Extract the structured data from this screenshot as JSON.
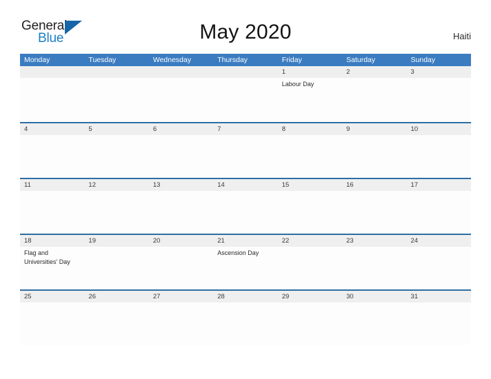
{
  "brand": {
    "name_part1": "General",
    "name_part2": "Blue",
    "flag_icon": "blue-triangle-flag-icon",
    "accent_color": "#1d7ec4"
  },
  "header": {
    "title": "May 2020",
    "country": "Haiti"
  },
  "colors": {
    "weekday_header_bg": "#3b7cc1",
    "week_divider": "#2e6da4",
    "date_band_bg": "#efefef",
    "cell_bg": "#fdfdfd",
    "page_bg": "#ffffff"
  },
  "calendar": {
    "month": "May",
    "year": "2020",
    "weekday_headers": [
      "Monday",
      "Tuesday",
      "Wednesday",
      "Thursday",
      "Friday",
      "Saturday",
      "Sunday"
    ],
    "weeks": [
      {
        "days": [
          {
            "number": "",
            "events": []
          },
          {
            "number": "",
            "events": []
          },
          {
            "number": "",
            "events": []
          },
          {
            "number": "",
            "events": []
          },
          {
            "number": "1",
            "events": [
              "Labour Day"
            ]
          },
          {
            "number": "2",
            "events": []
          },
          {
            "number": "3",
            "events": []
          }
        ]
      },
      {
        "days": [
          {
            "number": "4",
            "events": []
          },
          {
            "number": "5",
            "events": []
          },
          {
            "number": "6",
            "events": []
          },
          {
            "number": "7",
            "events": []
          },
          {
            "number": "8",
            "events": []
          },
          {
            "number": "9",
            "events": []
          },
          {
            "number": "10",
            "events": []
          }
        ]
      },
      {
        "days": [
          {
            "number": "11",
            "events": []
          },
          {
            "number": "12",
            "events": []
          },
          {
            "number": "13",
            "events": []
          },
          {
            "number": "14",
            "events": []
          },
          {
            "number": "15",
            "events": []
          },
          {
            "number": "16",
            "events": []
          },
          {
            "number": "17",
            "events": []
          }
        ]
      },
      {
        "days": [
          {
            "number": "18",
            "events": [
              "Flag and Universities' Day"
            ]
          },
          {
            "number": "19",
            "events": []
          },
          {
            "number": "20",
            "events": []
          },
          {
            "number": "21",
            "events": [
              "Ascension Day"
            ]
          },
          {
            "number": "22",
            "events": []
          },
          {
            "number": "23",
            "events": []
          },
          {
            "number": "24",
            "events": []
          }
        ]
      },
      {
        "days": [
          {
            "number": "25",
            "events": []
          },
          {
            "number": "26",
            "events": []
          },
          {
            "number": "27",
            "events": []
          },
          {
            "number": "28",
            "events": []
          },
          {
            "number": "29",
            "events": []
          },
          {
            "number": "30",
            "events": []
          },
          {
            "number": "31",
            "events": []
          }
        ]
      }
    ]
  }
}
